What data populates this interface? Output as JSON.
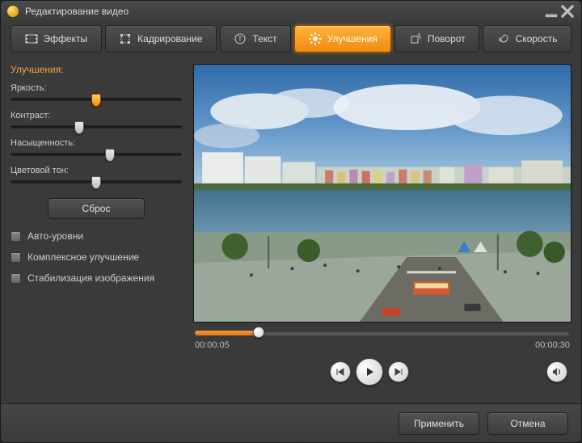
{
  "title": "Редактирование видео",
  "tabs": {
    "effects": "Эффекты",
    "crop": "Кадрирование",
    "text": "Текст",
    "enhance": "Улучшения",
    "rotate": "Поворот",
    "speed": "Скорость"
  },
  "section": {
    "title": "Улучшения:",
    "brightness": {
      "label": "Яркость:",
      "value": 50
    },
    "contrast": {
      "label": "Контраст:",
      "value": 40
    },
    "saturation": {
      "label": "Насыщенность:",
      "value": 58
    },
    "hue": {
      "label": "Цветовой тон:",
      "value": 50
    },
    "reset": "Сброс",
    "auto_levels": "Авто-уровни",
    "complex_enhance": "Комплексное улучшение",
    "stabilize": "Стабилизация изображения"
  },
  "player": {
    "position_pct": 17,
    "time_current": "00:00:05",
    "time_total": "00:00:30"
  },
  "footer": {
    "apply": "Применить",
    "cancel": "Отмена"
  }
}
